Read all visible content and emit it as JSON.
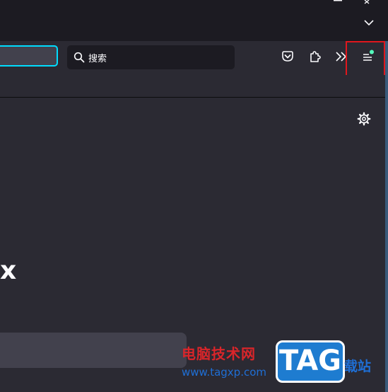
{
  "search": {
    "placeholder": "搜索"
  },
  "toolbar": {
    "pocket_icon": "pocket-icon",
    "extensions_icon": "puzzle-icon",
    "overflow_icon": "chevron-double-right-icon",
    "menu_icon": "hamburger-menu-icon",
    "update_dot_color": "#54ffbd"
  },
  "newtab": {
    "brand_fragment": "x"
  },
  "watermark": {
    "site_name": "电脑技术网",
    "url": "www.tagxp.com",
    "badge": "TAG",
    "side": "载站"
  },
  "colors": {
    "tabbar_bg": "#1c1b22",
    "toolbar_bg": "#2b2a33",
    "focus_ring": "#00ddff",
    "highlight": "#e0171d"
  }
}
